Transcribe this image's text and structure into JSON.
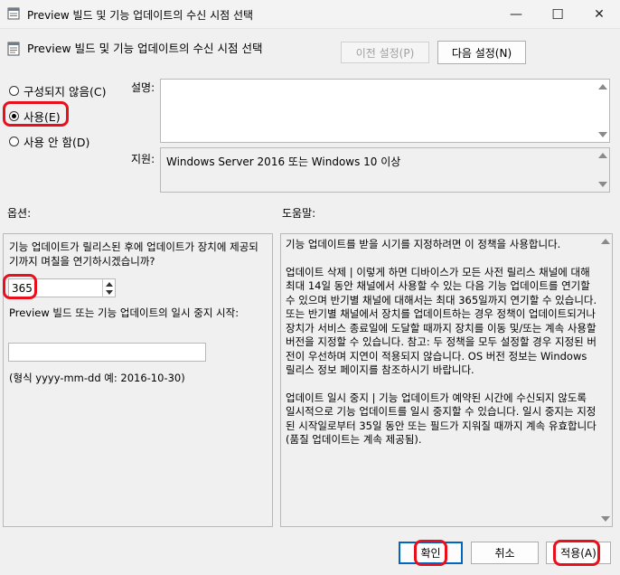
{
  "window": {
    "title": "Preview 빌드 및 기능 업데이트의 수신 시점 선택",
    "minimize": "—",
    "maximize": "☐",
    "close": "✕"
  },
  "header": {
    "policy_title": "Preview 빌드 및 기능 업데이트의 수신 시점 선택",
    "prev_button": "이전 설정(P)",
    "next_button": "다음 설정(N)"
  },
  "state": {
    "options": [
      {
        "label": "구성되지 않음(C)",
        "selected": false
      },
      {
        "label": "사용(E)",
        "selected": true
      },
      {
        "label": "사용 안 함(D)",
        "selected": false
      }
    ]
  },
  "comment": {
    "label": "설명:",
    "value": ""
  },
  "supported": {
    "label": "지원:",
    "value": "Windows Server 2016 또는 Windows 10 이상"
  },
  "options_label": "옵션:",
  "help_label": "도움말:",
  "options": {
    "defer_question": "기능 업데이트가 릴리스된 후에 업데이트가 장치에 제공되기까지 며칠을 연기하시겠습니까?",
    "defer_value": "365",
    "pause_label": "Preview 빌드 또는 기능 업데이트의 일시 중지 시작:",
    "pause_value": "",
    "format_hint": "(형식 yyyy-mm-dd 예: 2016-10-30)"
  },
  "help": {
    "p1": "기능 업데이트를 받을 시기를 지정하려면 이 정책을 사용합니다.",
    "p2": "업데이트 삭제 | 이렇게 하면 디바이스가 모든 사전 릴리스 채널에 대해 최대 14일 동안 채널에서 사용할 수 있는 다음 기능 업데이트를 연기할 수 있으며 반기별 채널에 대해서는 최대 365일까지 연기할 수 있습니다. 또는 반기별 채널에서 장치를 업데이트하는 경우 정책이 업데이트되거나 장치가 서비스 종료일에 도달할 때까지 장치를 이동 및/또는 계속 사용할 버전을 지정할 수 있습니다. 참고: 두 정책을 모두 설정할 경우 지정된 버전이 우선하며 지연이 적용되지 않습니다. OS 버전 정보는 Windows 릴리스 정보 페이지를 참조하시기 바랍니다.",
    "p3": " 업데이트 일시 중지 | 기능 업데이트가 예약된 시간에 수신되지 않도록 일시적으로 기능 업데이트를 일시 중지할 수 있습니다. 일시 중지는 지정된 시작일로부터 35일 동안 또는 필드가 지워질 때까지 계속 유효합니다(품질 업데이트는 계속 제공됨)."
  },
  "footer": {
    "ok": "확인",
    "cancel": "취소",
    "apply": "적용(A)"
  },
  "colors": {
    "highlight": "#e8101c"
  }
}
